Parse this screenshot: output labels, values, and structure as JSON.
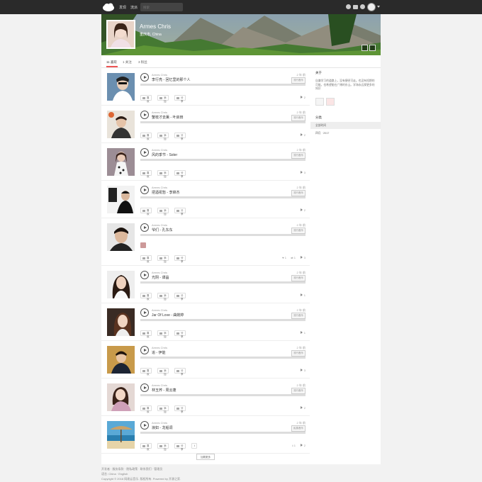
{
  "nav": {
    "discover": "发现",
    "stream": "流派",
    "search_placeholder": "搜索"
  },
  "profile": {
    "name": "Armes Chris",
    "location": "重庆市, China"
  },
  "tabs": [
    {
      "label": "11 喜欢"
    },
    {
      "label": "1 关注"
    },
    {
      "label": "3 粉丝"
    }
  ],
  "actions": {
    "like": "喜欢",
    "add": "添加",
    "share": "分享"
  },
  "tracks": [
    {
      "artist": "Armes Chris",
      "title": "李行亮 - 回忆里的那个人",
      "time": "2 年 前",
      "badge": "流行音乐",
      "plays": "2"
    },
    {
      "artist": "Armes Chris",
      "title": "蟹枝才去薰 - 叶启田",
      "time": "2 年 前",
      "badge": "流行音乐",
      "plays": "2"
    },
    {
      "artist": "Armes Chris",
      "title": "风的季节 - Soler",
      "time": "2 年 前",
      "badge": "流行音乐",
      "plays": "3"
    },
    {
      "artist": "Armes Chris",
      "title": "把酒祝愁 - 李锦杰",
      "time": "2 年 前",
      "badge": "流行音乐",
      "plays": "2"
    },
    {
      "artist": "Armes Chris",
      "title": "爷们 - 孔东东",
      "time": "2 年 前",
      "badge": "流行音乐",
      "plays": "3",
      "likes": "1",
      "reposts": "1"
    },
    {
      "artist": "Armes Chris",
      "title": "光阴 - 谭晶",
      "time": "2 年 前",
      "badge": "流行音乐",
      "plays": "1"
    },
    {
      "artist": "Armes Chris",
      "title": "Jar Of Love - 曲婉婷",
      "time": "2 年 前",
      "badge": "流行音乐",
      "plays": "1"
    },
    {
      "artist": "Armes Chris",
      "title": "追 - 伊能",
      "time": "2 年 前",
      "badge": "流行音乐",
      "plays": "3"
    },
    {
      "artist": "Armes Chris",
      "title": "林玉荞 - 周云蓬",
      "time": "2 年 前",
      "badge": "流行音乐",
      "plays": "2"
    },
    {
      "artist": "Armes Chris",
      "title": "浪如 - 龙船调",
      "time": "2 年 前",
      "badge": "民族音乐",
      "plays": "2",
      "downloads": "1"
    }
  ],
  "side": {
    "about_heading": "关于",
    "about_text": "自谦学习的道路上，没有捷径可走。也没有短期的可能。也希望能在广博的东山。学海永远探更多的知识",
    "category_heading": "分类",
    "categories": [
      {
        "label": "全部时间"
      },
      {
        "label": "四月 · 2017"
      }
    ]
  },
  "load_more": "加载更多",
  "footer": {
    "links": "开发者 · 服务条款 · 隐私政策 · 联系我们 · 管理员",
    "language": "语言: China · English",
    "copyright": "Copyright © 2016 网易云音乐. 版权所有. Powered by 开源之家."
  }
}
